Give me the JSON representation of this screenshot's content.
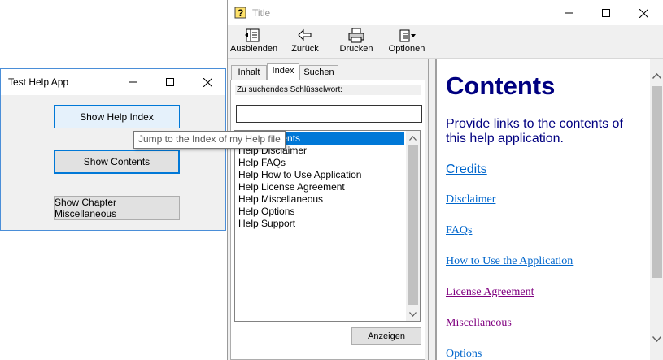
{
  "app_window": {
    "title": "Test Help App",
    "buttons": {
      "show_help_index": "Show Help Index",
      "show_contents": "Show Contents",
      "show_chapter_misc": "Show Chapter Miscellaneous"
    }
  },
  "tooltip": {
    "text": "Jump to the Index of my Help file"
  },
  "help_window": {
    "title": "Title",
    "toolbar": {
      "hide": "Ausblenden",
      "back": "Zurück",
      "print": "Drucken",
      "options": "Optionen"
    },
    "tabs": {
      "contents": "Inhalt",
      "index": "Index",
      "search": "Suchen"
    },
    "keyword_label": "Zu suchendes Schlüsselwort:",
    "keyword_value": "",
    "index_items": [
      "Help Contents",
      "Help Disclaimer",
      "Help FAQs",
      "Help How to Use Application",
      "Help License Agreement",
      "Help Miscellaneous",
      "Help Options",
      "Help Support"
    ],
    "display_button": "Anzeigen",
    "content": {
      "title": "Contents",
      "description": "Provide links to the contents of this help application.",
      "links": {
        "credits": "Credits",
        "disclaimer": "Disclaimer",
        "faqs": "FAQs",
        "how_to": "How to Use the Application",
        "license": "License Agreement",
        "misc": "Miscellaneous",
        "options": "Options"
      }
    }
  },
  "colors": {
    "heading": "#000080",
    "link": "#0066cc",
    "visited_link": "#800080",
    "selection": "#0078d7",
    "focus_border": "#0078d7"
  }
}
